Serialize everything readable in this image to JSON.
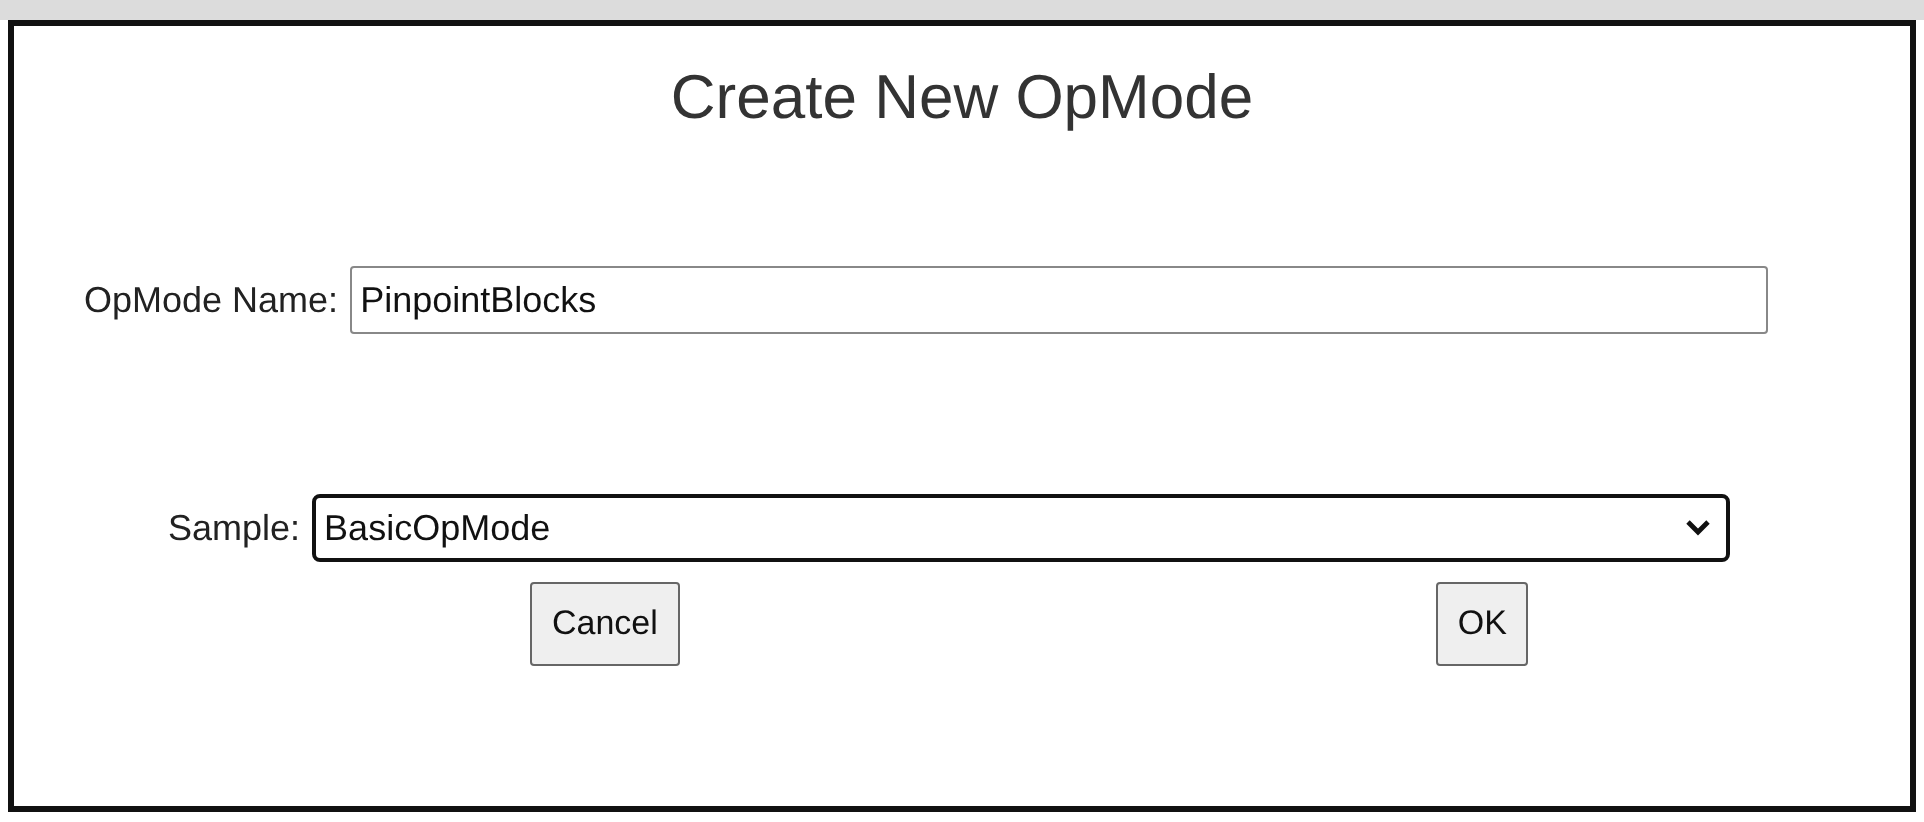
{
  "dialog": {
    "title": "Create New OpMode",
    "name_field": {
      "label": "OpMode Name:",
      "value": "PinpointBlocks"
    },
    "sample_field": {
      "label": "Sample:",
      "value": "BasicOpMode"
    },
    "buttons": [
      {
        "label": "Cancel"
      },
      {
        "label": "OK"
      }
    ]
  }
}
